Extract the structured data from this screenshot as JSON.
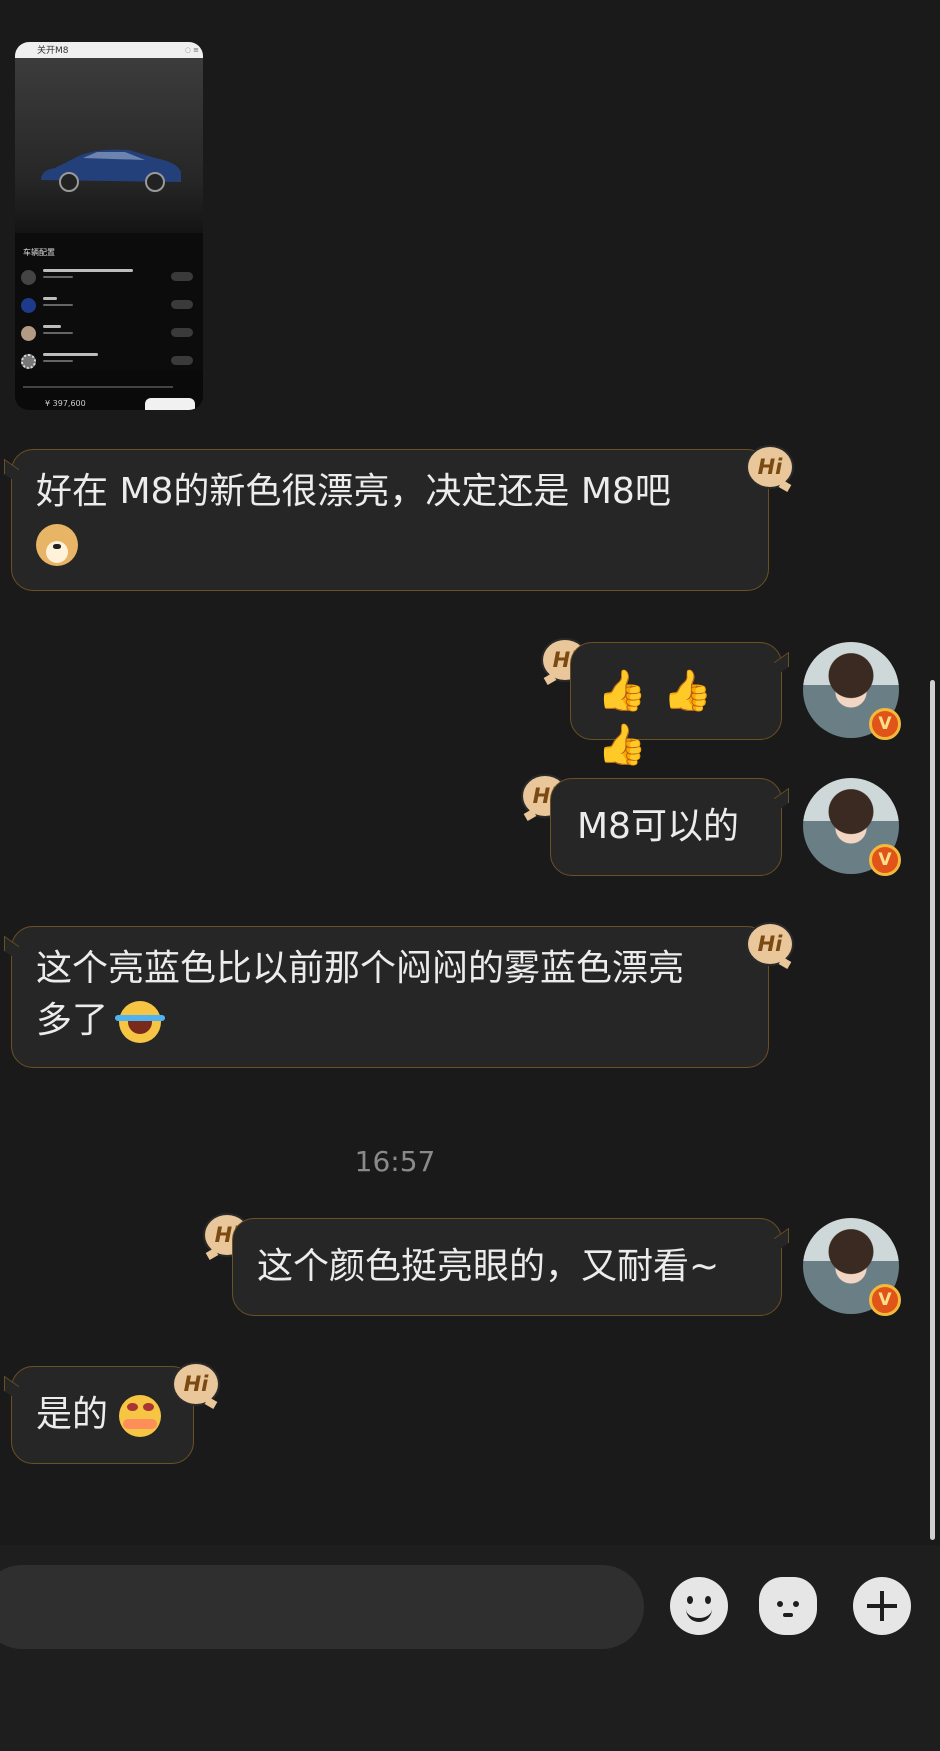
{
  "shared_image": {
    "header": "关开M8",
    "config_title": "车辆配置",
    "price": "¥ 397,600"
  },
  "messages": [
    {
      "text": "好在 M8的新色很漂亮，决定还是 M8吧",
      "emoji": "doge"
    },
    {
      "text": "👍 👍 👍",
      "emoji": "thumbs-up"
    },
    {
      "text": "M8可以的"
    },
    {
      "text": "这个亮蓝色比以前那个闷闷的雾蓝色漂亮\n多了",
      "emoji": "laugh-cry"
    },
    {
      "text": "这个颜色挺亮眼的，又耐看~"
    },
    {
      "text": "是的",
      "emoji": "hug"
    }
  ],
  "hi_badge": "Hi",
  "avatar_badge": "V",
  "timestamp": "16:57",
  "colors": {
    "background": "#1a1a1a",
    "bubble": "#262626",
    "bubble_border": "#6b5023",
    "hi_badge": "#e9c79a"
  }
}
